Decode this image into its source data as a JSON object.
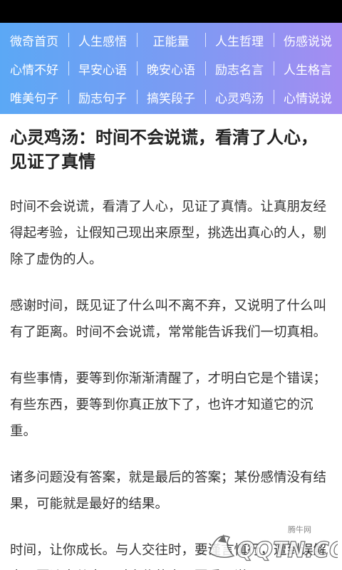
{
  "nav": {
    "items": [
      "微奇首页",
      "人生感悟",
      "正能量",
      "人生哲理",
      "伤感说说",
      "心情不好",
      "早安心语",
      "晚安心语",
      "励志名言",
      "人生格言",
      "唯美句子",
      "励志句子",
      "搞笑段子",
      "心灵鸡汤",
      "心情说说"
    ]
  },
  "article": {
    "title": "心灵鸡汤：时间不会说谎，看清了人心，见证了真情",
    "paragraphs": [
      "时间不会说谎，看清了人心，见证了真情。让真朋友经得起考验，让假知己现出来原型，挑选出真心的人，剔除了虚伪的人。",
      "感谢时间，既见证了什么叫不离不弃，又说明了什么叫有了距离。时间不会说谎，常常能告诉我们一切真相。",
      "有些事情，要等到你渐渐清醒了，才明白它是个错误；有些东西，要等到你真正放下了，也许才知道它的沉重。",
      "诸多问题没有答案，就是最后的答案；某份感情没有结果，可能就是最好的结果。",
      "时间，让你成长。与人交往时，要谨言慎行，遭到误解中，要淡定从容，对虚伪的人，要看不说"
    ]
  },
  "watermark": {
    "small_text": "腾牛网",
    "logo_text": "QQTN.COM"
  },
  "colors": {
    "nav_gradient_start": "#5ba8f5",
    "nav_gradient_end": "#a58cf2",
    "status_bar": "#000000"
  }
}
